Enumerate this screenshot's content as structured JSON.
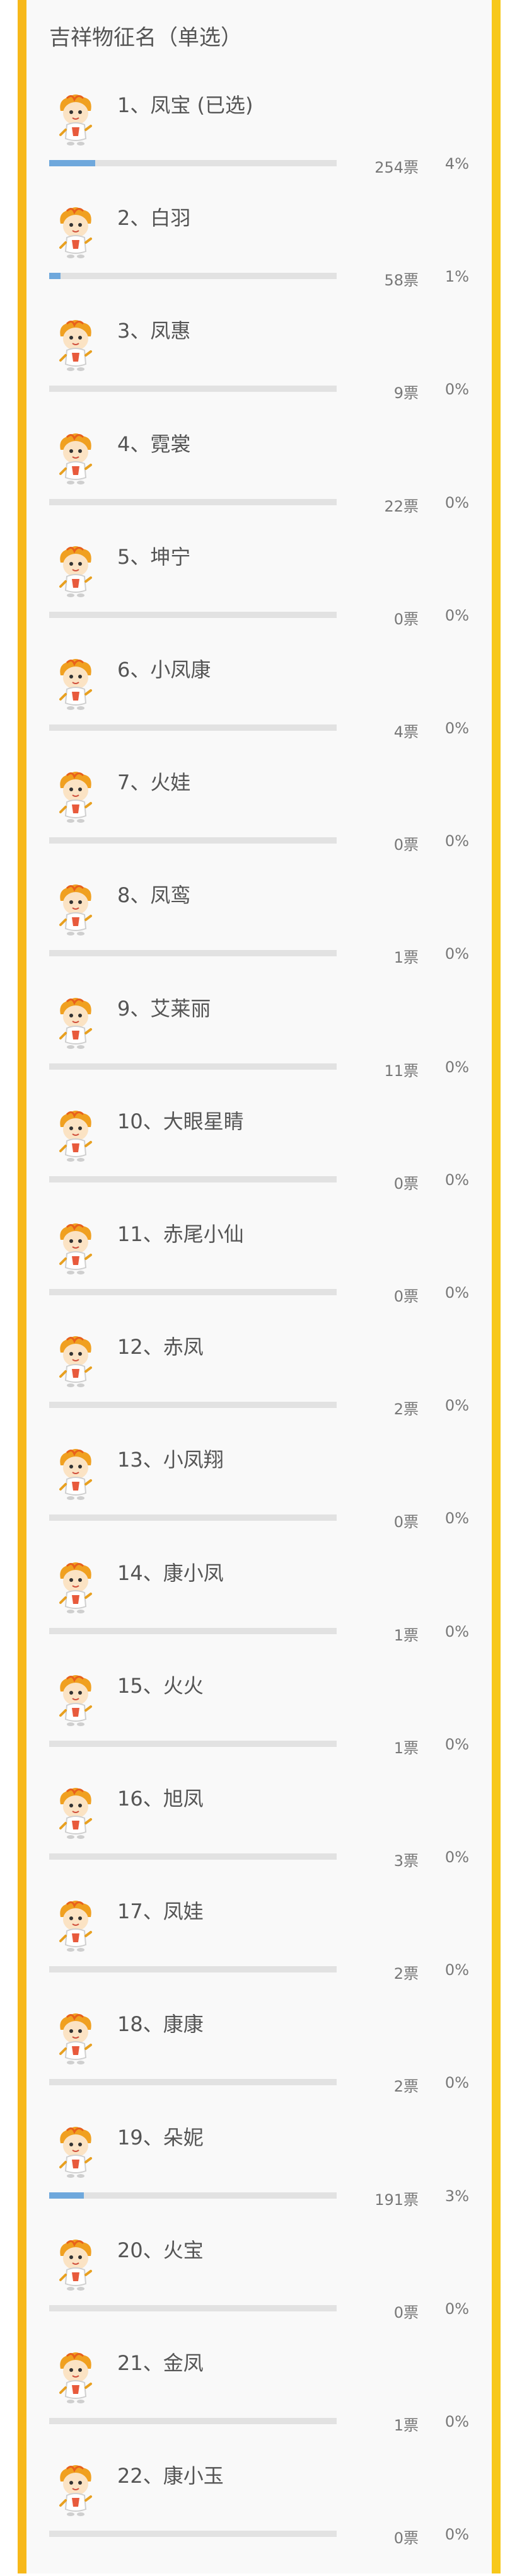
{
  "title": "吉祥物征名（单选）",
  "colors": {
    "rail": "#f7b81a",
    "bar_fill": "#6fa8dc",
    "bar_track": "#e2e2e2",
    "text": "#555555"
  },
  "options": [
    {
      "label": "1、凤宝 (已选)",
      "votes": "254票",
      "percent": "4%",
      "share": 0.04
    },
    {
      "label": "2、白羽",
      "votes": "58票",
      "percent": "1%",
      "share": 0.01
    },
    {
      "label": "3、凤惠",
      "votes": "9票",
      "percent": "0%",
      "share": 0
    },
    {
      "label": "4、霓裳",
      "votes": "22票",
      "percent": "0%",
      "share": 0
    },
    {
      "label": "5、坤宁",
      "votes": "0票",
      "percent": "0%",
      "share": 0
    },
    {
      "label": "6、小凤康",
      "votes": "4票",
      "percent": "0%",
      "share": 0
    },
    {
      "label": "7、火娃",
      "votes": "0票",
      "percent": "0%",
      "share": 0
    },
    {
      "label": "8、凤鸾",
      "votes": "1票",
      "percent": "0%",
      "share": 0
    },
    {
      "label": "9、艾莱丽",
      "votes": "11票",
      "percent": "0%",
      "share": 0
    },
    {
      "label": "10、大眼星睛",
      "votes": "0票",
      "percent": "0%",
      "share": 0
    },
    {
      "label": "11、赤尾小仙",
      "votes": "0票",
      "percent": "0%",
      "share": 0
    },
    {
      "label": "12、赤凤",
      "votes": "2票",
      "percent": "0%",
      "share": 0
    },
    {
      "label": "13、小凤翔",
      "votes": "0票",
      "percent": "0%",
      "share": 0
    },
    {
      "label": "14、康小凤",
      "votes": "1票",
      "percent": "0%",
      "share": 0
    },
    {
      "label": "15、火火",
      "votes": "1票",
      "percent": "0%",
      "share": 0
    },
    {
      "label": "16、旭凤",
      "votes": "3票",
      "percent": "0%",
      "share": 0
    },
    {
      "label": "17、凤娃",
      "votes": "2票",
      "percent": "0%",
      "share": 0
    },
    {
      "label": "18、康康",
      "votes": "2票",
      "percent": "0%",
      "share": 0
    },
    {
      "label": "19、朵妮",
      "votes": "191票",
      "percent": "3%",
      "share": 0.03
    },
    {
      "label": "20、火宝",
      "votes": "0票",
      "percent": "0%",
      "share": 0
    },
    {
      "label": "21、金凤",
      "votes": "1票",
      "percent": "0%",
      "share": 0
    },
    {
      "label": "22、康小玉",
      "votes": "0票",
      "percent": "0%",
      "share": 0
    }
  ]
}
